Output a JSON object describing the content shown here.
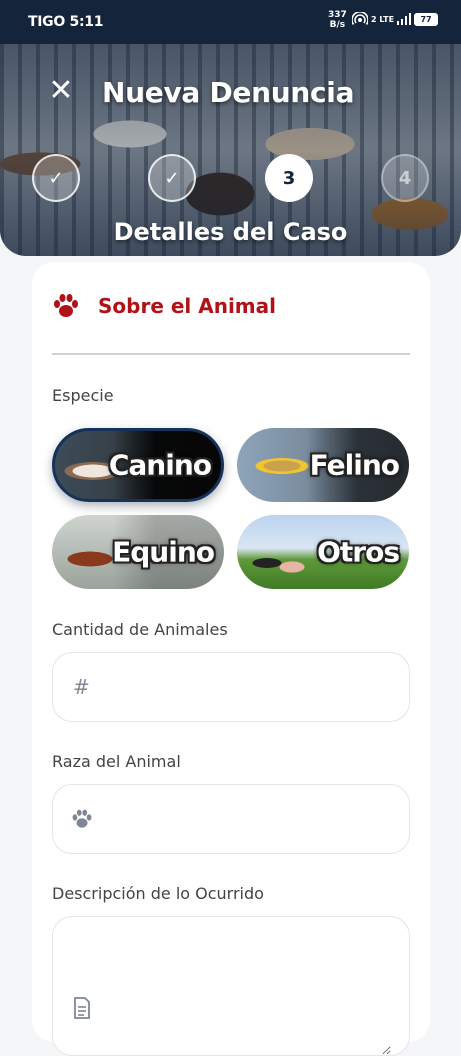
{
  "status_bar": {
    "carrier_time": "TIGO 5:11",
    "speed_value": "337",
    "speed_unit": "B/s",
    "network": "2 LTE",
    "battery": "77"
  },
  "header": {
    "title": "Nueva Denuncia",
    "close_icon": "close-icon",
    "steps": [
      {
        "label": "✓",
        "state": "done"
      },
      {
        "label": "✓",
        "state": "done"
      },
      {
        "label": "3",
        "state": "current"
      },
      {
        "label": "4",
        "state": "upcoming"
      }
    ],
    "step_title": "Detalles del Caso"
  },
  "section": {
    "icon": "paw-icon",
    "title": "Sobre el Animal",
    "accent_color": "#b11217"
  },
  "species": {
    "label": "Especie",
    "options": [
      {
        "label": "Canino",
        "selected": true
      },
      {
        "label": "Felino",
        "selected": false
      },
      {
        "label": "Equino",
        "selected": false
      },
      {
        "label": "Otros",
        "selected": false
      }
    ]
  },
  "quantity": {
    "label": "Cantidad de Animales",
    "icon": "hash-icon",
    "icon_glyph": "#",
    "value": ""
  },
  "breed": {
    "label": "Raza del Animal",
    "icon": "paw-icon",
    "value": ""
  },
  "description": {
    "label": "Descripción de lo Ocurrido",
    "icon": "document-icon",
    "value": ""
  }
}
